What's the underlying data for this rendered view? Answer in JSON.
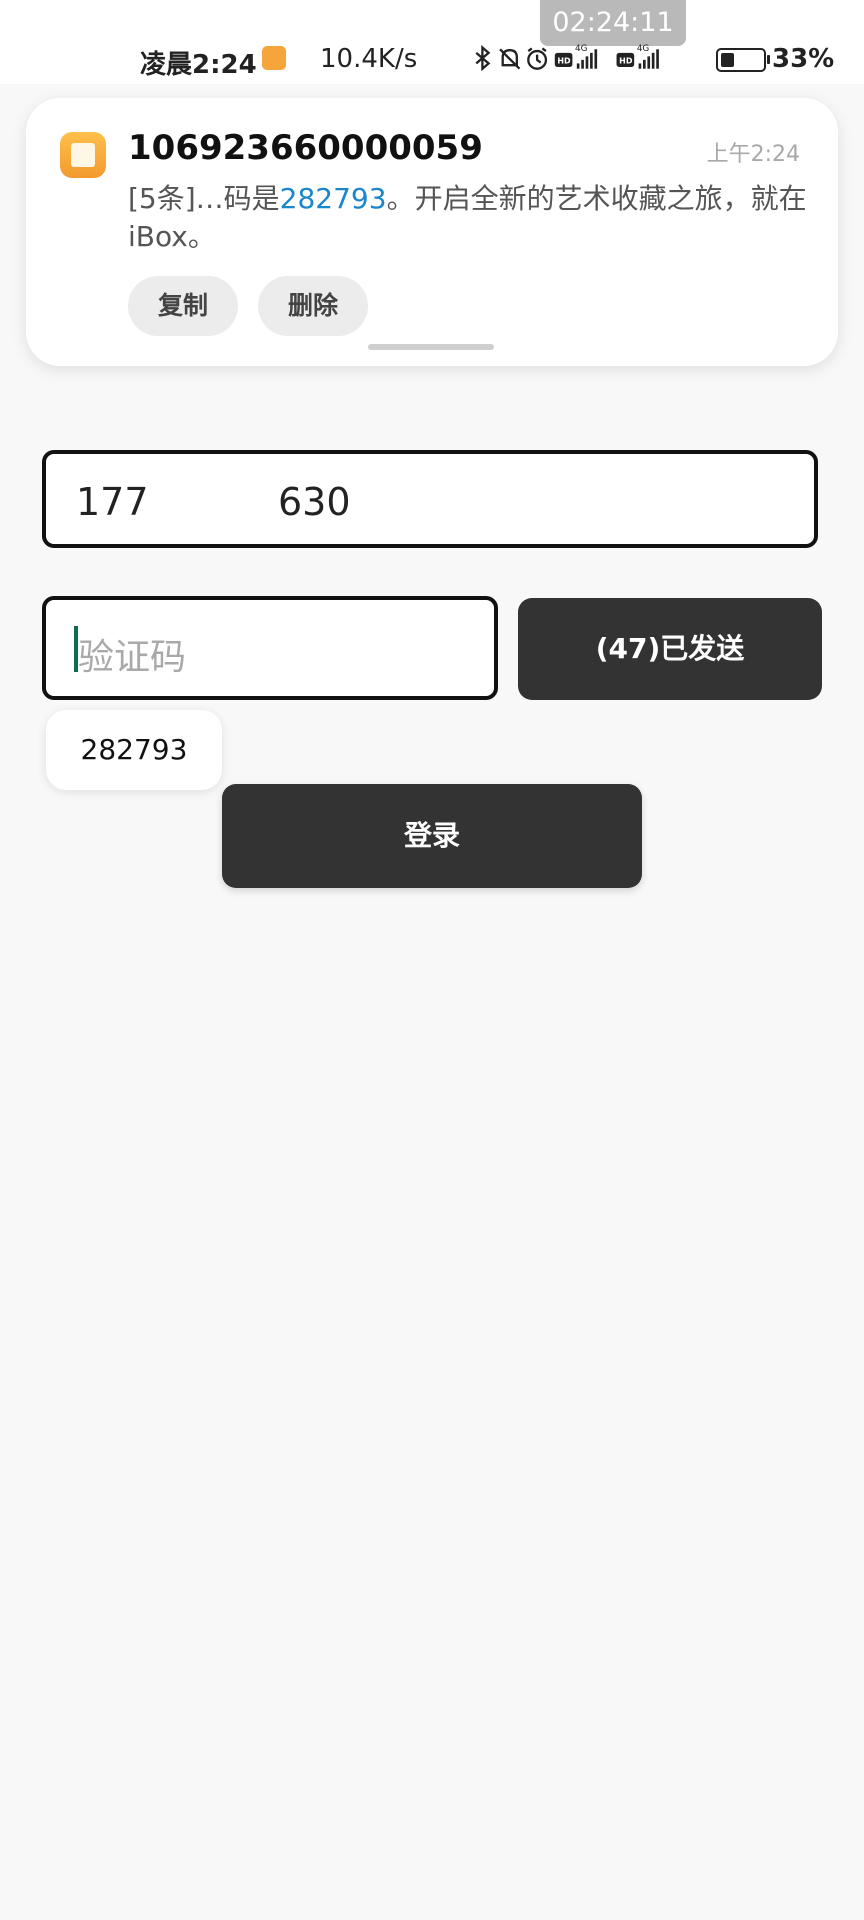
{
  "status_bar": {
    "recording_timer": "02:24:11",
    "time": "凌晨2:24",
    "net_speed": "10.4K/s",
    "network_1": "HD 4G",
    "network_2": "HD 4G",
    "battery_percent": 33,
    "battery_text": "33%",
    "icons": [
      "bluetooth-icon",
      "bell-muted-icon",
      "alarm-icon",
      "signal-icon",
      "signal-icon"
    ]
  },
  "notification": {
    "sender": "106923660000059",
    "time": "上午2:24",
    "message_prefix": "[5条]…码是",
    "message_code": "282793",
    "message_suffix": "。开启全新的艺术收藏之旅，就在iBox。",
    "actions": {
      "copy": "复制",
      "delete": "删除"
    },
    "code_color": "#1a86cc"
  },
  "page": {
    "title": "登录"
  },
  "form": {
    "phone_value_start": "177",
    "phone_value_end": "630",
    "code_placeholder": "验证码",
    "send_button": "(47)已发送",
    "autofill_suggestion": "282793",
    "login_button": "登录",
    "button_color": "#333333"
  }
}
